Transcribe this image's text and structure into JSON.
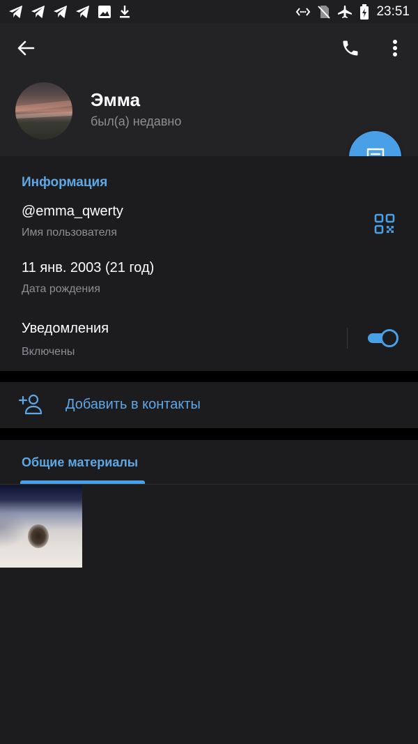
{
  "status_bar": {
    "time": "23:51",
    "left_icons": [
      "telegram-icon",
      "telegram-icon",
      "telegram-icon",
      "telegram-icon",
      "image-icon",
      "download-icon"
    ],
    "right_icons": [
      "data-saver-icon",
      "no-sim-icon",
      "airplane-icon",
      "battery-charging-icon"
    ]
  },
  "app_bar": {
    "back_icon": "arrow-back-icon",
    "call_icon": "phone-icon",
    "menu_icon": "more-vert-icon"
  },
  "profile": {
    "name": "Эмма",
    "status": "был(а) недавно"
  },
  "info": {
    "title": "Информация",
    "username_value": "@emma_qwerty",
    "username_label": "Имя пользователя",
    "birthday_value": "11 янв. 2003 (21 год)",
    "birthday_label": "Дата рождения",
    "notifications_value": "Уведомления",
    "notifications_label": "Включены",
    "notifications_enabled": true
  },
  "actions": {
    "add_contact": "Добавить в контакты"
  },
  "media": {
    "tab_label": "Общие материалы",
    "item_count": 1
  },
  "colors": {
    "accent": "#4aa0e6",
    "accent_text": "#5fa8e6",
    "background": "#1c1c1e",
    "header_background": "#232325",
    "secondary_text": "#8e8e93"
  }
}
